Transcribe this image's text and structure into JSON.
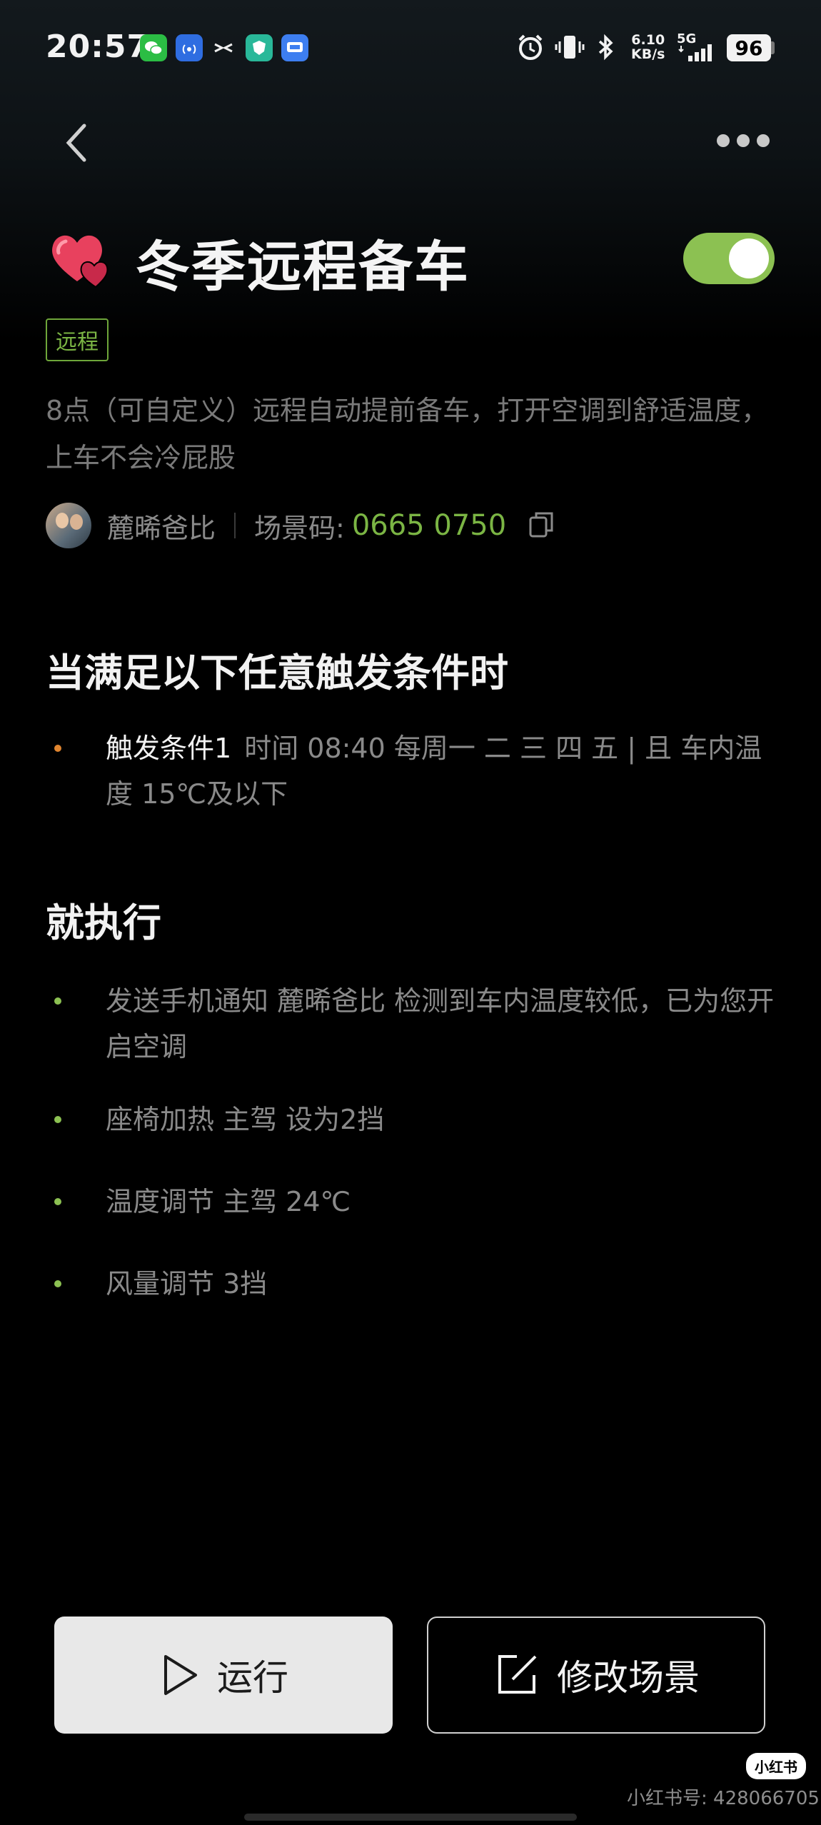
{
  "status_bar": {
    "time": "20:57",
    "network_speed_value": "6.10",
    "network_speed_unit": "KB/s",
    "network_type": "5G",
    "battery": "96",
    "app_icons": [
      "wechat-icon",
      "radio-1-icon",
      "xiaohongshu-x-icon",
      "shield-icon",
      "chat-window-icon"
    ],
    "system_icons": [
      "alarm-icon",
      "vibrate-icon",
      "bluetooth-icon",
      "signal-icon"
    ]
  },
  "header": {
    "back_icon": "chevron-left-icon",
    "more_icon": "more-dots-icon"
  },
  "scene": {
    "title": "冬季远程备车",
    "icon": "heart-icon",
    "enabled": true,
    "tag": "远程",
    "description": "8点（可自定义）远程自动提前备车，打开空调到舒适温度，上车不会冷屁股",
    "author": "麓晞爸比",
    "code_label": "场景码:",
    "code_value": "0665 0750"
  },
  "conditions": {
    "heading": "当满足以下任意触发条件时",
    "items": [
      {
        "name": "触发条件1",
        "detail": "时间 08:40 每周一 二 三 四 五 | 且 车内温度 15℃及以下"
      }
    ]
  },
  "actions": {
    "heading": "就执行",
    "items": [
      "发送手机通知 麓晞爸比 检测到车内温度较低，已为您开启空调",
      "座椅加热 主驾 设为2挡",
      "温度调节 主驾 24℃",
      "风量调节 3挡"
    ]
  },
  "buttons": {
    "run": "运行",
    "edit": "修改场景"
  },
  "watermark": {
    "badge": "小红书",
    "text": "小红书号: 428066705"
  },
  "colors": {
    "accent_green": "#8cc152",
    "trigger_dot": "#e0852f",
    "background": "#000000"
  }
}
